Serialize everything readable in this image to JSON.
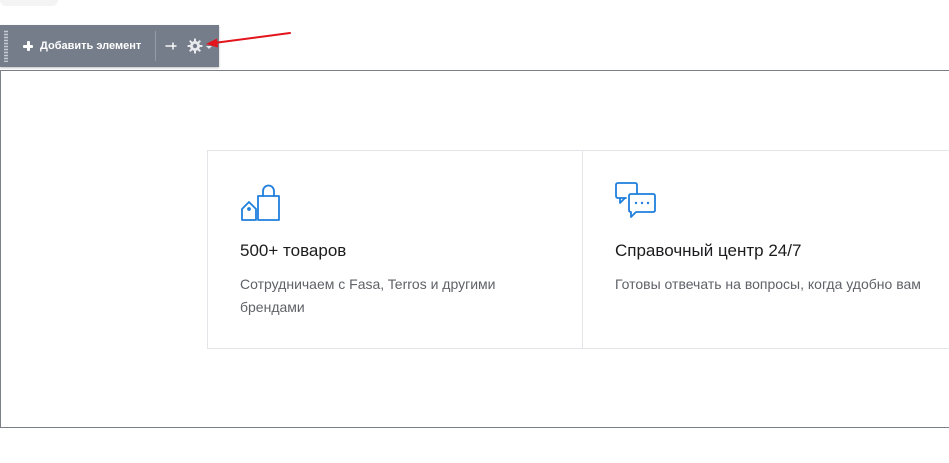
{
  "toolbar": {
    "add_label": "Добавить элемент",
    "icons": [
      "drag-handle-icon",
      "plus-icon",
      "pin-icon",
      "gear-icon",
      "chevron-down-icon"
    ],
    "background": "#757d8b"
  },
  "annotation": {
    "arrow_color": "#e3141b"
  },
  "features": [
    {
      "icon": "shopping-bags-icon",
      "title": "500+ товаров",
      "description": "Сотрудничаем с Fasa, Terros и другими брендами"
    },
    {
      "icon": "chat-bubbles-icon",
      "title": "Справочный центр 24/7",
      "description": "Готовы отвечать на вопросы, когда удобно вам"
    }
  ],
  "colors": {
    "accent_blue": "#1f7fdc",
    "title_text": "#1c1c1e",
    "desc_text": "#5f6268",
    "card_border": "#e3e5e8"
  }
}
